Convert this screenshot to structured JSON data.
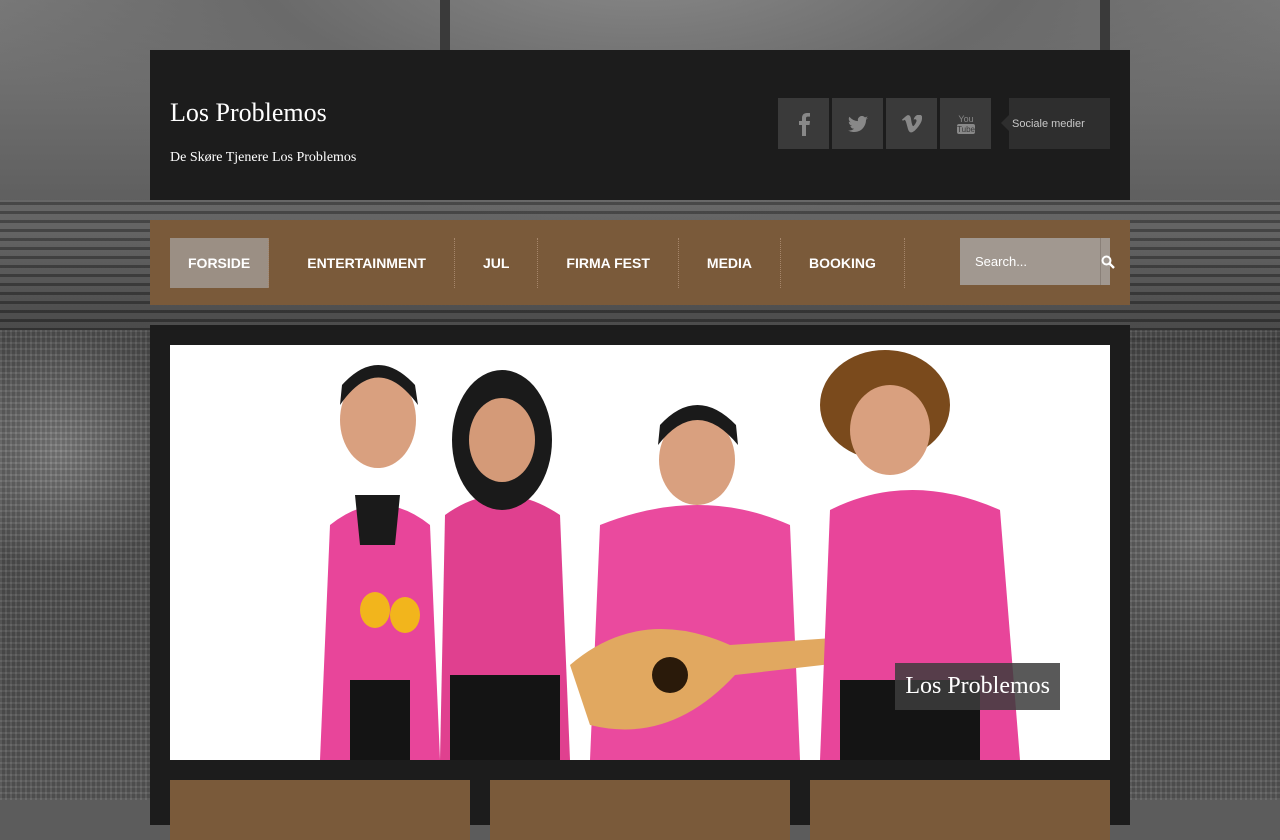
{
  "site": {
    "title": "Los Problemos",
    "tagline": "De Skøre Tjenere Los Problemos"
  },
  "social": {
    "icons": [
      "facebook-icon",
      "twitter-icon",
      "vimeo-icon",
      "youtube-icon"
    ],
    "label": "Sociale medier"
  },
  "nav": {
    "items": [
      {
        "label": "FORSIDE",
        "active": true
      },
      {
        "label": "ENTERTAINMENT"
      },
      {
        "label": "JUL"
      },
      {
        "label": "FIRMA FEST"
      },
      {
        "label": "MEDIA"
      },
      {
        "label": "BOOKING"
      }
    ]
  },
  "search": {
    "placeholder": "Search..."
  },
  "slider": {
    "caption": "Los Problemos"
  },
  "colors": {
    "header_bg": "#1c1c1c",
    "nav_bg": "#7a5a3a",
    "active_nav": "#9b8f84",
    "shirt_pink": "#e8459a"
  }
}
